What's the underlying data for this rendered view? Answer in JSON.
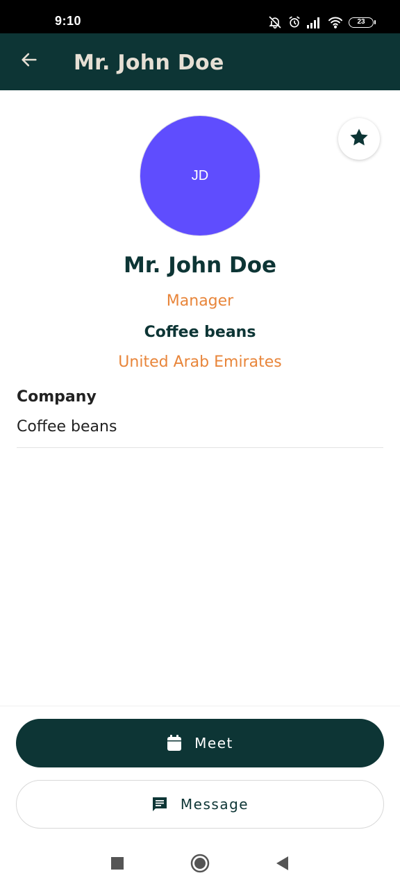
{
  "status_bar": {
    "time": "9:10",
    "battery": "23",
    "icons": [
      "bell-off-icon",
      "alarm-icon",
      "signal-icon",
      "wifi-icon",
      "battery-icon"
    ]
  },
  "app_bar": {
    "title": "Mr. John Doe",
    "back_icon": "arrow-left-icon",
    "background": "#0d3535"
  },
  "profile": {
    "initials": "JD",
    "avatar_color": "#5f4dfe",
    "name": "Mr. John Doe",
    "role": "Manager",
    "company": "Coffee beans",
    "country": "United Arab Emirates",
    "favorite_icon": "star-icon"
  },
  "fields": [
    {
      "label": "Company",
      "value": "Coffee beans"
    }
  ],
  "actions": {
    "meet_label": "Meet",
    "meet_icon": "calendar-icon",
    "message_label": "Message",
    "message_icon": "chat-icon"
  },
  "nav": {
    "icons": [
      "recents-square-icon",
      "home-circle-icon",
      "back-triangle-icon"
    ]
  },
  "colors": {
    "primary": "#0d3535",
    "accent": "#e8853a",
    "text": "#222222"
  }
}
